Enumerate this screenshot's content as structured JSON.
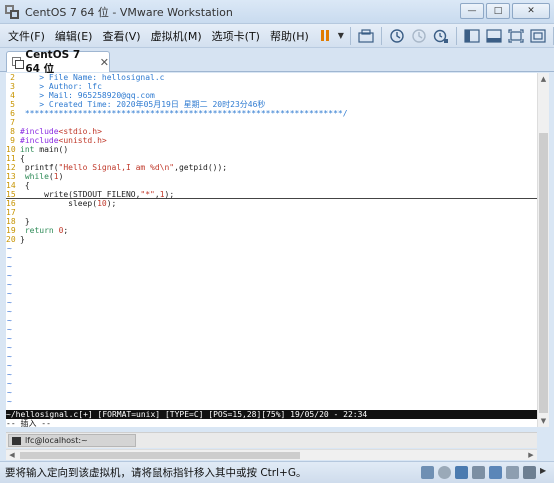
{
  "window": {
    "title": "CentOS 7 64 位 - VMware Workstation"
  },
  "menu": [
    "文件(F)",
    "编辑(E)",
    "查看(V)",
    "虚拟机(M)",
    "选项卡(T)",
    "帮助(H)"
  ],
  "tab": {
    "label": "CentOS 7 64 位"
  },
  "editor": {
    "lines": [
      {
        "n": "2",
        "segs": [
          {
            "c": "cmt",
            "t": "    > File Name: hellosignal.c"
          }
        ]
      },
      {
        "n": "3",
        "segs": [
          {
            "c": "cmt",
            "t": "    > Author: lfc"
          }
        ]
      },
      {
        "n": "4",
        "segs": [
          {
            "c": "cmt",
            "t": "    > Mail: 965258920@qq.com"
          }
        ]
      },
      {
        "n": "5",
        "segs": [
          {
            "c": "cmt",
            "t": "    > Created Time: 2020年05月19日 星期二 20时23分46秒"
          }
        ]
      },
      {
        "n": "6",
        "segs": [
          {
            "c": "cmt",
            "t": " ******************************************************************/"
          }
        ]
      },
      {
        "n": "7",
        "segs": [
          {
            "c": "code",
            "t": ""
          }
        ]
      },
      {
        "n": "8",
        "segs": [
          {
            "c": "inc",
            "t": "#include"
          },
          {
            "c": "str",
            "t": "<stdio.h>"
          }
        ]
      },
      {
        "n": "9",
        "segs": [
          {
            "c": "inc",
            "t": "#include"
          },
          {
            "c": "str",
            "t": "<unistd.h>"
          }
        ]
      },
      {
        "n": "10",
        "segs": [
          {
            "c": "kw",
            "t": "int"
          },
          {
            "c": "code",
            "t": " main()"
          }
        ]
      },
      {
        "n": "11",
        "segs": [
          {
            "c": "code",
            "t": "{"
          }
        ]
      },
      {
        "n": "12",
        "segs": [
          {
            "c": "code",
            "t": " printf("
          },
          {
            "c": "str",
            "t": "\"Hello Signal,I am %d\\n\""
          },
          {
            "c": "code",
            "t": ",getpid());"
          }
        ]
      },
      {
        "n": "13",
        "segs": [
          {
            "c": "code",
            "t": " "
          },
          {
            "c": "kw",
            "t": "while"
          },
          {
            "c": "code",
            "t": "("
          },
          {
            "c": "num",
            "t": "1"
          },
          {
            "c": "code",
            "t": ")"
          }
        ]
      },
      {
        "n": "14",
        "segs": [
          {
            "c": "code",
            "t": " {"
          }
        ]
      },
      {
        "n": "15",
        "segs": [
          {
            "c": "code",
            "t": "     write(STDOUT_FILENO,"
          },
          {
            "c": "str",
            "t": "\"*\""
          },
          {
            "c": "code",
            "t": ","
          },
          {
            "c": "num",
            "t": "1"
          },
          {
            "c": "code",
            "t": ");"
          }
        ],
        "cursor": true
      },
      {
        "n": "16",
        "segs": [
          {
            "c": "code",
            "t": "          sleep("
          },
          {
            "c": "num",
            "t": "10"
          },
          {
            "c": "code",
            "t": ");"
          }
        ]
      },
      {
        "n": "17",
        "segs": [
          {
            "c": "code",
            "t": ""
          }
        ]
      },
      {
        "n": "18",
        "segs": [
          {
            "c": "code",
            "t": " }"
          }
        ]
      },
      {
        "n": "19",
        "segs": [
          {
            "c": "code",
            "t": " "
          },
          {
            "c": "kw",
            "t": "return"
          },
          {
            "c": "code",
            "t": " "
          },
          {
            "c": "num",
            "t": "0"
          },
          {
            "c": "code",
            "t": ";"
          }
        ]
      },
      {
        "n": "20",
        "segs": [
          {
            "c": "code",
            "t": "}"
          }
        ]
      }
    ],
    "tilde_rows": 18,
    "status_line": "~/hellosignal.c[+] [FORMAT=unix] [TYPE=C] [POS=15,28][75%] 19/05/20 - 22:34",
    "mode_line": "-- 插入 --"
  },
  "guest_task": {
    "label": "lfc@localhost:~"
  },
  "statusbar": {
    "text": "要将输入定向到该虚拟机，请将鼠标指针移入其中或按 Ctrl+G。"
  }
}
